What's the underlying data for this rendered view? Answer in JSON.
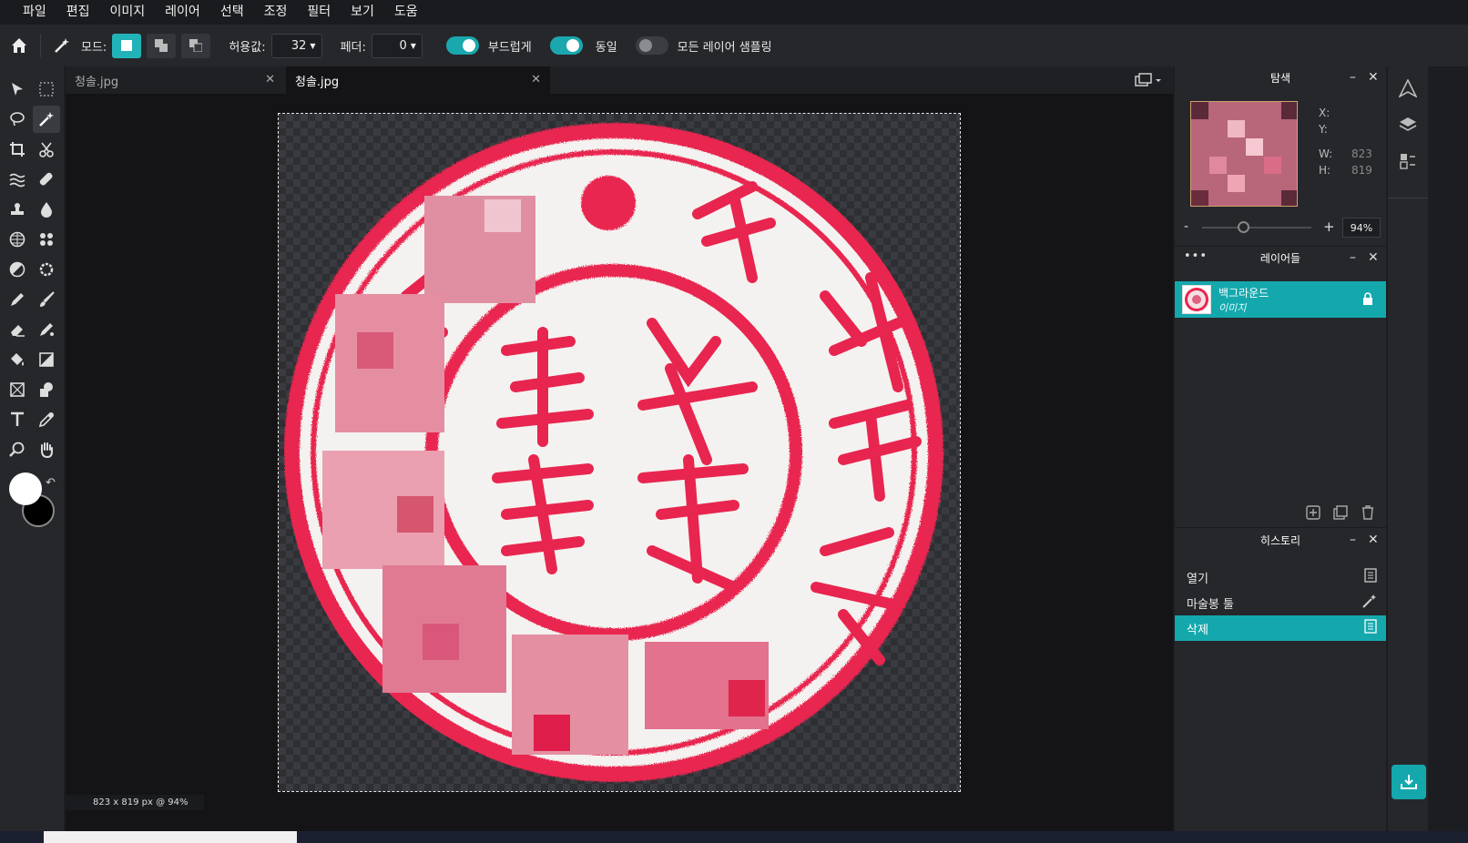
{
  "menu": [
    "파일",
    "편집",
    "이미지",
    "레이어",
    "선택",
    "조정",
    "필터",
    "보기",
    "도움"
  ],
  "toolbar": {
    "mode_label": "모드:",
    "tolerance_label": "허용값:",
    "tolerance_value": "32",
    "feather_label": "페더:",
    "feather_value": "0",
    "smooth_label": "부드럽게",
    "smooth_on": true,
    "contiguous_label": "동일",
    "contiguous_on": true,
    "sample_all_label": "모든 레이어 샘플링",
    "sample_all_on": false
  },
  "tabs": [
    {
      "label": "청솔.jpg",
      "active": false
    },
    {
      "label": "청솔.jpg",
      "active": true
    }
  ],
  "status": "823 x 819 px @ 94%",
  "navigator": {
    "title": "탐색",
    "x_label": "X:",
    "y_label": "Y:",
    "w_label": "W:",
    "w_value": "823",
    "h_label": "H:",
    "h_value": "819",
    "zoom": "94%"
  },
  "layers": {
    "title": "레이어들",
    "items": [
      {
        "name": "백그라운드",
        "type": "이미지",
        "locked": true
      }
    ]
  },
  "history": {
    "title": "히스토리",
    "items": [
      {
        "label": "열기",
        "selected": false
      },
      {
        "label": "마술봉 툴",
        "selected": false
      },
      {
        "label": "삭제",
        "selected": true
      }
    ]
  },
  "colors": {
    "accent": "#14a8ad",
    "stamp_red": "#e8254f",
    "foreground": "#ffffff",
    "background": "#000000"
  }
}
